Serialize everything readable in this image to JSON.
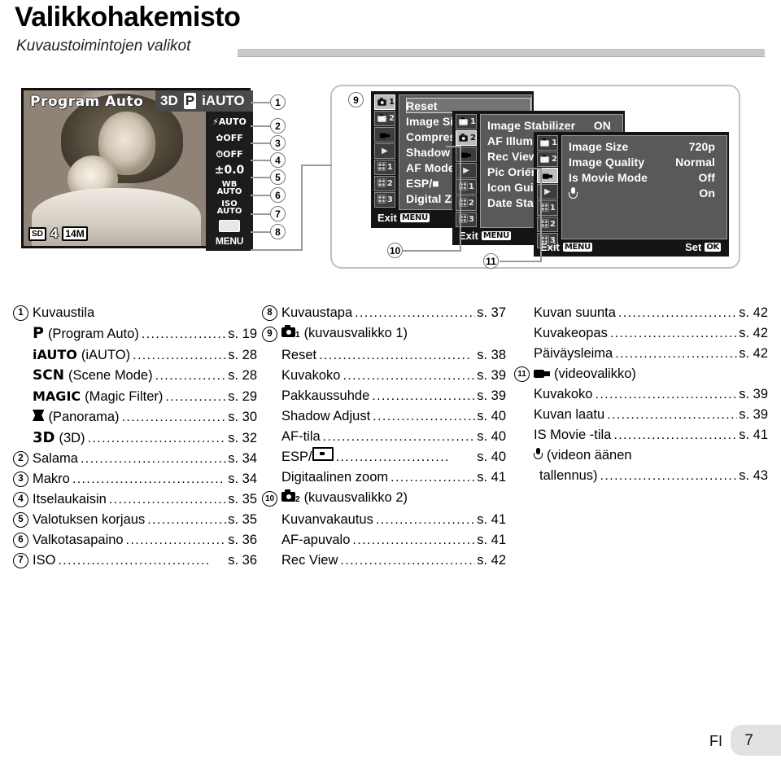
{
  "header": {
    "title": "Valikkohakemisto",
    "subtitle": "Kuvaustoimintojen valikot"
  },
  "camera_screen": {
    "mode_label": "Program Auto",
    "top_bar": {
      "left": "3D",
      "mid": "P",
      "right": "iAUTO"
    },
    "side_items": [
      {
        "id": "flash",
        "line1": "AUTO",
        "icon": "flash-icon"
      },
      {
        "id": "macro",
        "line1": "OFF",
        "icon": "macro-flower-icon"
      },
      {
        "id": "selftimer",
        "line1": "OFF",
        "icon": "self-timer-icon"
      },
      {
        "id": "exposure",
        "line1": "±0.0",
        "icon": "exposure-comp-icon"
      },
      {
        "id": "whitebalance",
        "line1": "WB",
        "line2": "AUTO",
        "icon": "white-balance-icon"
      },
      {
        "id": "iso",
        "line1": "ISO",
        "line2": "AUTO",
        "icon": "iso-icon"
      },
      {
        "id": "drive",
        "line1": "",
        "icon": "single-frame-icon"
      }
    ],
    "menu_label": "MENU",
    "bottom": {
      "card": "SD",
      "count": "4",
      "megapixels": "14M"
    }
  },
  "menu_panels": [
    {
      "id": "shooting-menu-1",
      "tabs": [
        "camera-1-tab",
        "camera-2-tab",
        "movie-tab",
        "playback-tab",
        "settings-1-tab",
        "settings-2-tab",
        "settings-3-tab"
      ],
      "selected_tab": 0,
      "rows": [
        {
          "label": "Reset",
          "value": "",
          "selected": true
        },
        {
          "label": "Image Size",
          "value": ""
        },
        {
          "label": "Compression",
          "value": ""
        },
        {
          "label": "Shadow Adjust",
          "value": ""
        },
        {
          "label": "AF Mode",
          "value": ""
        },
        {
          "label": "ESP/■",
          "value": ""
        },
        {
          "label": "Digital Zoom",
          "value": ""
        }
      ],
      "exit_label": "Exit",
      "exit_key": "MENU"
    },
    {
      "id": "shooting-menu-2",
      "tabs": [
        "camera-1-tab",
        "camera-2-tab",
        "movie-tab",
        "playback-tab",
        "settings-1-tab",
        "settings-2-tab",
        "settings-3-tab"
      ],
      "selected_tab": 1,
      "rows": [
        {
          "label": "Image Stabilizer",
          "value": "ON"
        },
        {
          "label": "AF Illuminat",
          "value": ""
        },
        {
          "label": "Rec View",
          "value": ""
        },
        {
          "label": "Pic Orientati",
          "value": ""
        },
        {
          "label": "Icon Guide",
          "value": ""
        },
        {
          "label": "Date Stamp",
          "value": ""
        }
      ],
      "exit_label": "Exit",
      "exit_key": "MENU"
    },
    {
      "id": "movie-menu",
      "tabs": [
        "camera-1-tab",
        "camera-2-tab",
        "movie-tab",
        "playback-tab",
        "settings-1-tab",
        "settings-2-tab",
        "settings-3-tab"
      ],
      "selected_tab": 2,
      "rows": [
        {
          "label": "Image Size",
          "value": "720p"
        },
        {
          "label": "Image Quality",
          "value": "Normal"
        },
        {
          "label": "Is Movie Mode",
          "value": "Off"
        },
        {
          "label": "",
          "icon": "microphone-icon",
          "value": "On"
        }
      ],
      "exit_label": "Exit",
      "exit_key": "MENU",
      "set_label": "Set",
      "set_key": "OK"
    }
  ],
  "callouts": [
    "1",
    "2",
    "3",
    "4",
    "5",
    "6",
    "7",
    "8",
    "9",
    "10",
    "11"
  ],
  "index": {
    "column_left": [
      {
        "num": "1",
        "text": "Kuvaustila",
        "dots": false,
        "page": ""
      },
      {
        "num": "",
        "glyph": "P",
        "glyph_style": "bold",
        "text": "(Program Auto)",
        "page": "s. 19"
      },
      {
        "num": "",
        "glyph": "iAUTO",
        "glyph_style": "bold",
        "text": "(iAUTO)",
        "page": "s. 28"
      },
      {
        "num": "",
        "glyph": "SCN",
        "glyph_style": "bold",
        "text": "(Scene Mode)",
        "page": "s. 28"
      },
      {
        "num": "",
        "glyph": "MAGIC",
        "glyph_style": "bold",
        "text": "(Magic Filter)",
        "page": "s. 29"
      },
      {
        "num": "",
        "glyph": "panorama-icon",
        "text": "(Panorama)",
        "page": "s. 30"
      },
      {
        "num": "",
        "glyph": "3D",
        "glyph_style": "bold",
        "text": "(3D)",
        "page": "s. 32"
      },
      {
        "num": "2",
        "text": "Salama",
        "page": "s. 34"
      },
      {
        "num": "3",
        "text": "Makro",
        "page": "s. 34"
      },
      {
        "num": "4",
        "text": "Itselaukaisin",
        "page": "s. 35"
      },
      {
        "num": "5",
        "text": "Valotuksen korjaus",
        "page": "s. 35"
      },
      {
        "num": "6",
        "text": "Valkotasapaino",
        "page": "s. 36"
      },
      {
        "num": "7",
        "text": "ISO",
        "page": "s. 36"
      }
    ],
    "column_middle": [
      {
        "num": "8",
        "text": "Kuvaustapa",
        "page": "s. 37"
      },
      {
        "num": "9",
        "glyph": "camera-icon",
        "glyph_sub": "1",
        "text": "(kuvausvalikko 1)",
        "dots": false,
        "page": ""
      },
      {
        "num": "",
        "text": "Reset",
        "page": "s. 38"
      },
      {
        "num": "",
        "text": "Kuvakoko",
        "page": "s. 39"
      },
      {
        "num": "",
        "text": "Pakkaussuhde",
        "page": "s. 39"
      },
      {
        "num": "",
        "text": "Shadow Adjust",
        "page": "s. 40"
      },
      {
        "num": "",
        "text": "AF-tila",
        "page": "s. 40"
      },
      {
        "num": "",
        "text": "ESP/",
        "glyph_after": "esp-spot-icon",
        "page": "s. 40"
      },
      {
        "num": "",
        "text": "Digitaalinen zoom",
        "page": "s. 41"
      },
      {
        "num": "10",
        "glyph": "camera-icon",
        "glyph_sub": "2",
        "text": "(kuvausvalikko 2)",
        "dots": false,
        "page": ""
      },
      {
        "num": "",
        "text": "Kuvanvakautus",
        "page": "s. 41"
      },
      {
        "num": "",
        "text": "AF-apuvalo",
        "page": "s. 41"
      },
      {
        "num": "",
        "text": "Rec View",
        "page": "s. 42"
      }
    ],
    "column_right": [
      {
        "num": "",
        "text": "Kuvan suunta",
        "page": "s. 42"
      },
      {
        "num": "",
        "text": "Kuvakeopas",
        "page": "s. 42"
      },
      {
        "num": "",
        "text": "Päiväysleima",
        "page": "s. 42"
      },
      {
        "num": "11",
        "glyph": "movie-icon",
        "text": "(videovalikko)",
        "dots": false,
        "page": ""
      },
      {
        "num": "",
        "text": "Kuvakoko",
        "page": "s. 39"
      },
      {
        "num": "",
        "text": "Kuvan laatu",
        "page": "s. 39"
      },
      {
        "num": "",
        "text": "IS Movie -tila",
        "page": "s. 41"
      },
      {
        "num": "",
        "glyph": "microphone-icon",
        "text": "(videon äänen",
        "dots": false,
        "page": ""
      },
      {
        "num": "",
        "text": "tallennus)",
        "page": "s. 43",
        "indent": true
      }
    ]
  },
  "footer": {
    "language": "FI",
    "page_number": "7"
  }
}
